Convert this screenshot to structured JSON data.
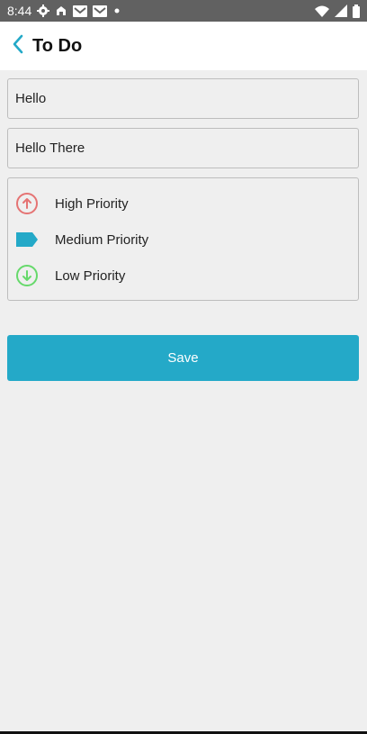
{
  "status_bar": {
    "time": "8:44",
    "left_icons": [
      "gear-icon",
      "notification-icon",
      "mail-icon",
      "mail-icon",
      "dot-icon"
    ],
    "right_icons": [
      "wifi-icon",
      "signal-icon",
      "battery-icon"
    ]
  },
  "header": {
    "title": "To Do",
    "back_icon": "chevron-left-icon"
  },
  "form": {
    "title_value": "Hello",
    "description_value": "Hello There"
  },
  "priority": {
    "options": [
      {
        "label": "High Priority",
        "icon": "arrow-up-circle-icon",
        "color": "#e57373"
      },
      {
        "label": "Medium Priority",
        "icon": "tag-icon",
        "color": "#24a9c8"
      },
      {
        "label": "Low Priority",
        "icon": "arrow-down-circle-icon",
        "color": "#66d96b"
      }
    ]
  },
  "actions": {
    "save_label": "Save"
  },
  "colors": {
    "accent": "#24a9c8",
    "status_bar": "#616161",
    "background": "#efefef"
  }
}
